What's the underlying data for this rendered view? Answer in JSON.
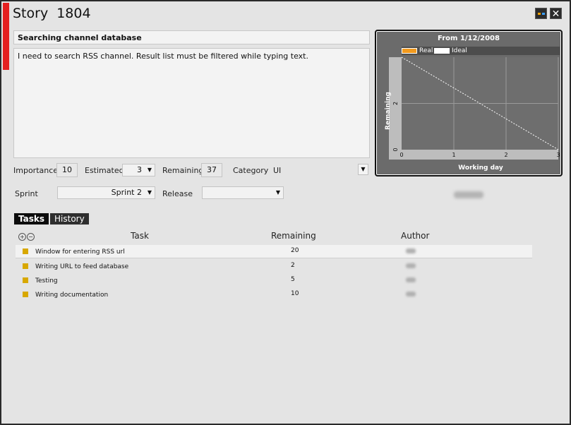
{
  "window": {
    "title": "Story",
    "number": "1804",
    "controls": [
      {
        "name": "theme-icon",
        "glyph": ""
      },
      {
        "name": "close-icon",
        "glyph": "✕"
      }
    ]
  },
  "story": {
    "name": "Searching channel database",
    "description": "I need to search RSS channel. Result list must be filtered while typing text."
  },
  "fields": {
    "importance_label": "Importance",
    "importance_value": "10",
    "estimated_label": "Estimated",
    "estimated_value": "3",
    "remaining_label": "Remaining",
    "remaining_value": "37",
    "category_label": "Category",
    "category_value": "UI",
    "sprint_label": "Sprint",
    "sprint_value": "Sprint 2",
    "release_label": "Release",
    "release_value": ""
  },
  "chart_data": {
    "type": "line",
    "title": "From 1/12/2008",
    "xlabel": "Working day",
    "ylabel": "Remaining",
    "x_ticks": [
      0,
      1,
      2,
      3
    ],
    "y_ticks": [
      0,
      2
    ],
    "xlim": [
      0,
      3
    ],
    "ylim": [
      0,
      4
    ],
    "grid": true,
    "legend_position": "top-left",
    "series": [
      {
        "name": "Real",
        "color": "#f29a1e",
        "x": [],
        "y": []
      },
      {
        "name": "Ideal",
        "color": "#ffffff",
        "x": [
          0,
          3
        ],
        "y": [
          4,
          0
        ]
      }
    ]
  },
  "tabs": [
    {
      "label": "Tasks",
      "active": true
    },
    {
      "label": "History",
      "active": false
    }
  ],
  "tasks": {
    "columns": {
      "task": "Task",
      "remaining": "Remaining",
      "author": "Author"
    },
    "expand_label": "+",
    "collapse_label": "−",
    "rows": [
      {
        "name": "Window for entering RSS url",
        "remaining": "20"
      },
      {
        "name": "Writing URL to feed database",
        "remaining": "2"
      },
      {
        "name": "Testing",
        "remaining": "5"
      },
      {
        "name": "Writing documentation",
        "remaining": "10"
      }
    ]
  },
  "colors": {
    "accent": "#e52020",
    "task_marker": "#d8a800",
    "chart_bg": "#6b6b6b",
    "chart_plot_bg": "#6e6e6e"
  }
}
